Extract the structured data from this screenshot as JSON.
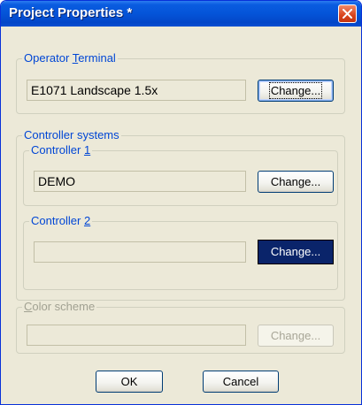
{
  "window": {
    "title": "Project Properties *"
  },
  "operator_terminal": {
    "label_pre": "Operator ",
    "label_mnemonic": "T",
    "label_post": "erminal",
    "value": "E1071 Landscape 1.5x",
    "change_label": "Change..."
  },
  "controller_systems": {
    "label": "Controller systems",
    "controller1": {
      "label_pre": "Controller ",
      "label_mnemonic": "1",
      "value": "DEMO",
      "change_label": "Change..."
    },
    "controller2": {
      "label_pre": "Controller ",
      "label_mnemonic": "2",
      "value": "",
      "change_label": "Change..."
    }
  },
  "color_scheme": {
    "label_mnemonic": "C",
    "label_post": "olor scheme",
    "value": "",
    "change_label": "Change..."
  },
  "footer": {
    "ok_label": "OK",
    "cancel_label": "Cancel"
  }
}
